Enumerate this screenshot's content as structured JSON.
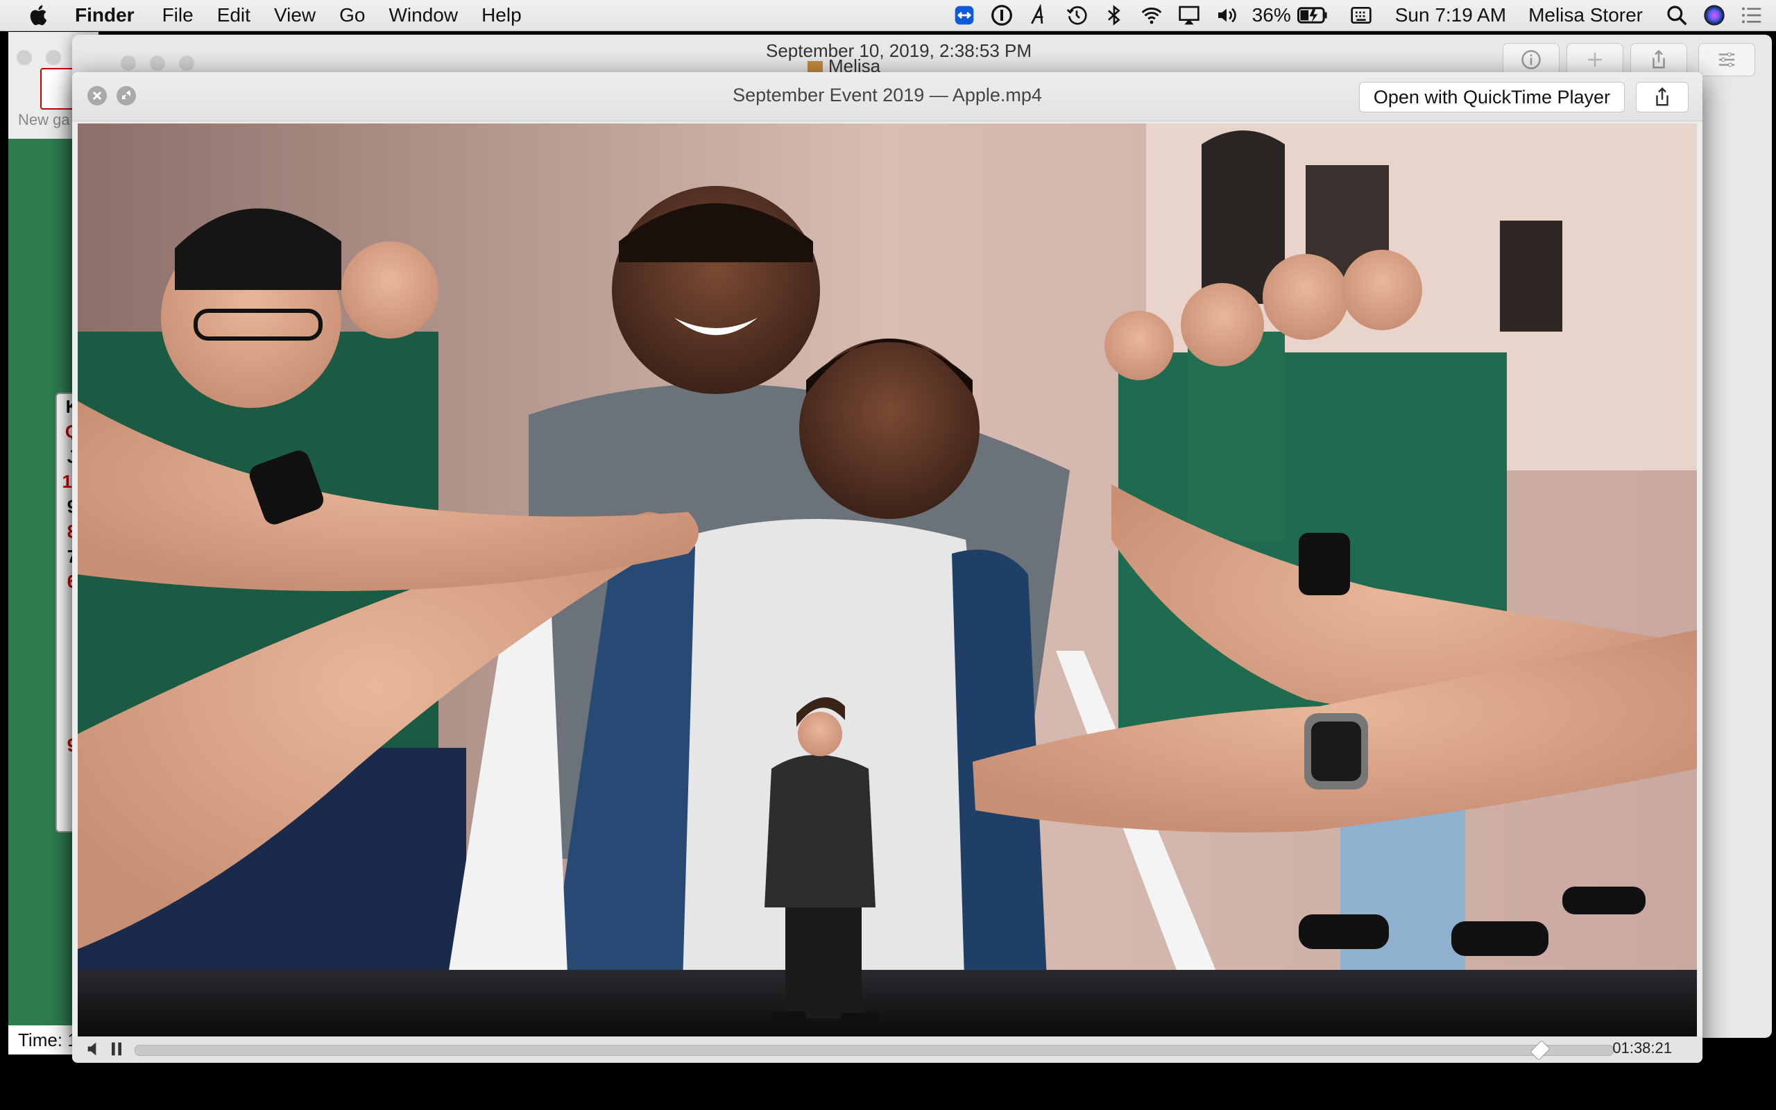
{
  "menubar": {
    "app_name": "Finder",
    "menus": [
      "File",
      "Edit",
      "View",
      "Go",
      "Window",
      "Help"
    ],
    "battery": "36%",
    "clock": "Sun 7:19 AM",
    "user": "Melisa Storer",
    "status_icons": [
      "teamviewer-icon",
      "1password-icon",
      "font-icon",
      "time-machine-icon",
      "bluetooth-icon",
      "wifi-icon",
      "airplay-icon",
      "volume-icon",
      "battery-icon",
      "keyboard-icon",
      "spotlight-icon",
      "siri-icon",
      "notification-center-icon"
    ]
  },
  "finder_back": {
    "date": "September 10, 2019, 2:38:53 PM",
    "folder": "Melisa"
  },
  "solitaire": {
    "new_game": "New ga",
    "time_label": "Time: 1",
    "cards": [
      "K",
      "Q",
      "J",
      "10",
      "9",
      "8",
      "7",
      "6",
      "",
      "9"
    ]
  },
  "quicklook": {
    "title": "September Event 2019 — Apple.mp4",
    "open_button": "Open with QuickTime Player",
    "elapsed_fraction": 0.95,
    "time_remaining": "01:38:21"
  },
  "colors": {
    "shirt_green": "#1f6b4f",
    "solitaire_felt": "#2e7d4f"
  }
}
